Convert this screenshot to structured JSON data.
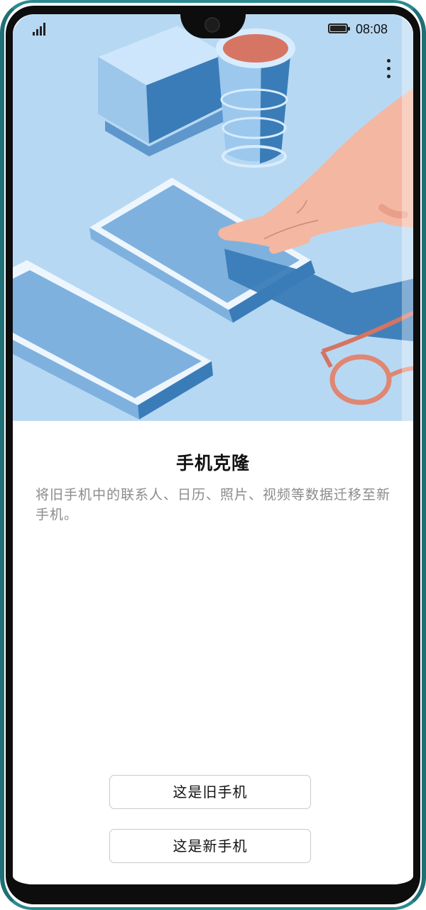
{
  "status_bar": {
    "time": "08:08",
    "signal_icon": "cellular-signal-icon",
    "battery_icon": "battery-icon"
  },
  "toolbar": {
    "more_icon": "more-vertical-icon"
  },
  "main": {
    "title": "手机克隆",
    "description": "将旧手机中的联系人、日历、照片、视频等数据迁移至新手机。"
  },
  "actions": {
    "old_phone_label": "这是旧手机",
    "new_phone_label": "这是新手机"
  },
  "colors": {
    "illustration_background": "#b7d8f2",
    "device_frame": "#1f6f76",
    "title_text": "#111111",
    "description_text": "#8b8b8b",
    "button_border": "#c9c9c9"
  }
}
